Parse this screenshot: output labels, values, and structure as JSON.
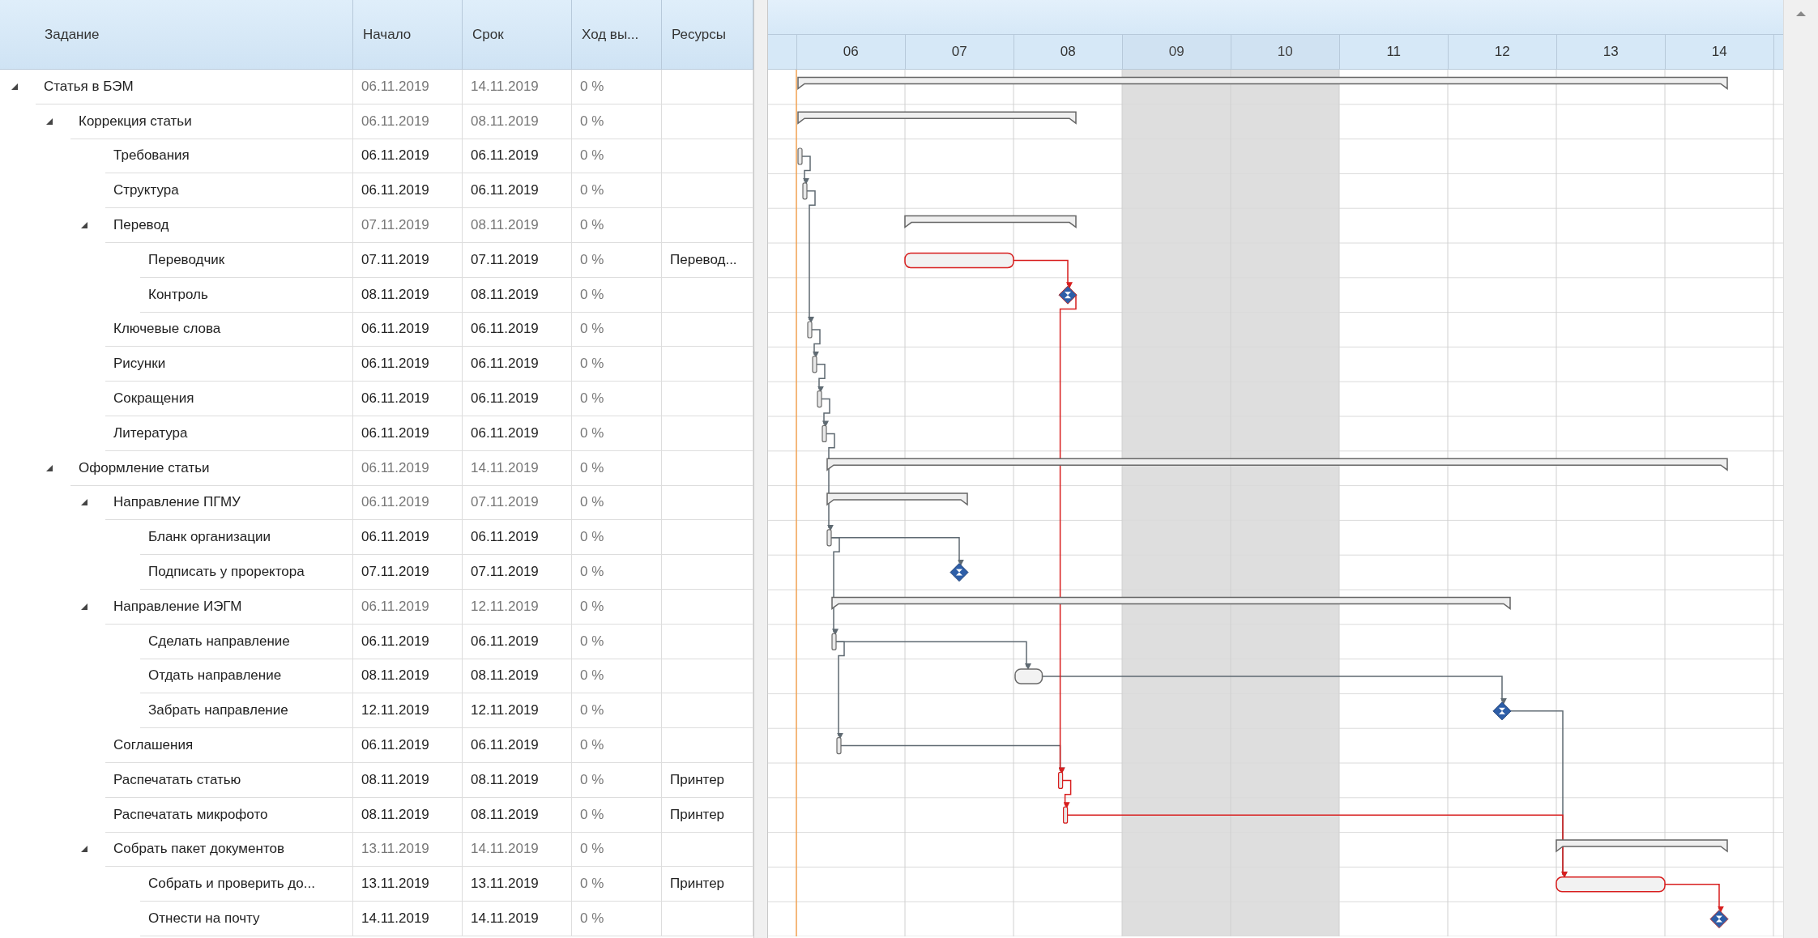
{
  "columns": [
    "Задание",
    "Начало",
    "Срок",
    "Ход вы...",
    "Ресурсы"
  ],
  "days": [
    {
      "label": "06",
      "weekend": false
    },
    {
      "label": "07",
      "weekend": false
    },
    {
      "label": "08",
      "weekend": false
    },
    {
      "label": "09",
      "weekend": true
    },
    {
      "label": "10",
      "weekend": true
    },
    {
      "label": "11",
      "weekend": false
    },
    {
      "label": "12",
      "weekend": false
    },
    {
      "label": "13",
      "weekend": false
    },
    {
      "label": "14",
      "weekend": false
    }
  ],
  "tasks": [
    {
      "name": "Статья в БЭМ",
      "start": "06.11.2019",
      "end": "14.11.2019",
      "progress": "0 %",
      "kind": "summary",
      "expanded": true,
      "children": [
        {
          "name": "Коррекция статьи",
          "start": "06.11.2019",
          "end": "08.11.2019",
          "progress": "0 %",
          "kind": "summary",
          "expanded": true,
          "children": [
            {
              "name": "Требования",
              "start": "06.11.2019",
              "end": "06.11.2019",
              "progress": "0 %",
              "kind": "instant",
              "critical": false
            },
            {
              "name": "Структура",
              "start": "06.11.2019",
              "end": "06.11.2019",
              "progress": "0 %",
              "kind": "instant",
              "critical": false
            },
            {
              "name": "Перевод",
              "start": "07.11.2019",
              "end": "08.11.2019",
              "progress": "0 %",
              "kind": "summary",
              "expanded": true,
              "children": [
                {
                  "name": "Переводчик",
                  "start": "07.11.2019",
                  "end": "07.11.2019",
                  "progress": "0 %",
                  "resources": "Перевод...",
                  "kind": "task",
                  "critical": true
                },
                {
                  "name": "Контроль",
                  "start": "08.11.2019",
                  "end": "08.11.2019",
                  "progress": "0 %",
                  "kind": "milestone",
                  "critical": true
                }
              ]
            },
            {
              "name": "Ключевые слова",
              "start": "06.11.2019",
              "end": "06.11.2019",
              "progress": "0 %",
              "kind": "instant",
              "critical": false
            },
            {
              "name": "Рисунки",
              "start": "06.11.2019",
              "end": "06.11.2019",
              "progress": "0 %",
              "kind": "instant",
              "critical": false
            },
            {
              "name": "Сокращения",
              "start": "06.11.2019",
              "end": "06.11.2019",
              "progress": "0 %",
              "kind": "instant",
              "critical": false
            },
            {
              "name": "Литература",
              "start": "06.11.2019",
              "end": "06.11.2019",
              "progress": "0 %",
              "kind": "instant",
              "critical": false
            }
          ]
        },
        {
          "name": "Оформление статьи",
          "start": "06.11.2019",
          "end": "14.11.2019",
          "progress": "0 %",
          "kind": "summary",
          "expanded": true,
          "children": [
            {
              "name": "Направление ПГМУ",
              "start": "06.11.2019",
              "end": "07.11.2019",
              "progress": "0 %",
              "kind": "summary",
              "expanded": true,
              "children": [
                {
                  "name": "Бланк организации",
                  "start": "06.11.2019",
                  "end": "06.11.2019",
                  "progress": "0 %",
                  "kind": "instant",
                  "critical": false
                },
                {
                  "name": "Подписать у проректора",
                  "start": "07.11.2019",
                  "end": "07.11.2019",
                  "progress": "0 %",
                  "kind": "milestone",
                  "critical": false
                }
              ]
            },
            {
              "name": "Направление ИЭГМ",
              "start": "06.11.2019",
              "end": "12.11.2019",
              "progress": "0 %",
              "kind": "summary",
              "expanded": true,
              "children": [
                {
                  "name": "Сделать направление",
                  "start": "06.11.2019",
                  "end": "06.11.2019",
                  "progress": "0 %",
                  "kind": "instant",
                  "critical": false
                },
                {
                  "name": "Отдать направление",
                  "start": "08.11.2019",
                  "end": "08.11.2019",
                  "progress": "0 %",
                  "kind": "brief",
                  "critical": false
                },
                {
                  "name": "Забрать направление",
                  "start": "12.11.2019",
                  "end": "12.11.2019",
                  "progress": "0 %",
                  "kind": "milestone",
                  "critical": false
                }
              ]
            },
            {
              "name": "Соглашения",
              "start": "06.11.2019",
              "end": "06.11.2019",
              "progress": "0 %",
              "kind": "instant",
              "critical": false
            },
            {
              "name": "Распечатать статью",
              "start": "08.11.2019",
              "end": "08.11.2019",
              "progress": "0 %",
              "resources": "Принтер",
              "kind": "instant",
              "critical": true
            },
            {
              "name": "Распечатать микрофото",
              "start": "08.11.2019",
              "end": "08.11.2019",
              "progress": "0 %",
              "resources": "Принтер",
              "kind": "instant",
              "critical": true
            },
            {
              "name": "Собрать пакет документов",
              "start": "13.11.2019",
              "end": "14.11.2019",
              "progress": "0 %",
              "kind": "summary",
              "expanded": true,
              "children": [
                {
                  "name": "Собрать и проверить до...",
                  "start": "13.11.2019",
                  "end": "13.11.2019",
                  "progress": "0 %",
                  "resources": "Принтер",
                  "kind": "task",
                  "critical": true
                },
                {
                  "name": "Отнести на почту",
                  "start": "14.11.2019",
                  "end": "14.11.2019",
                  "progress": "0 %",
                  "kind": "milestone",
                  "critical": true
                }
              ]
            }
          ]
        }
      ]
    }
  ]
}
